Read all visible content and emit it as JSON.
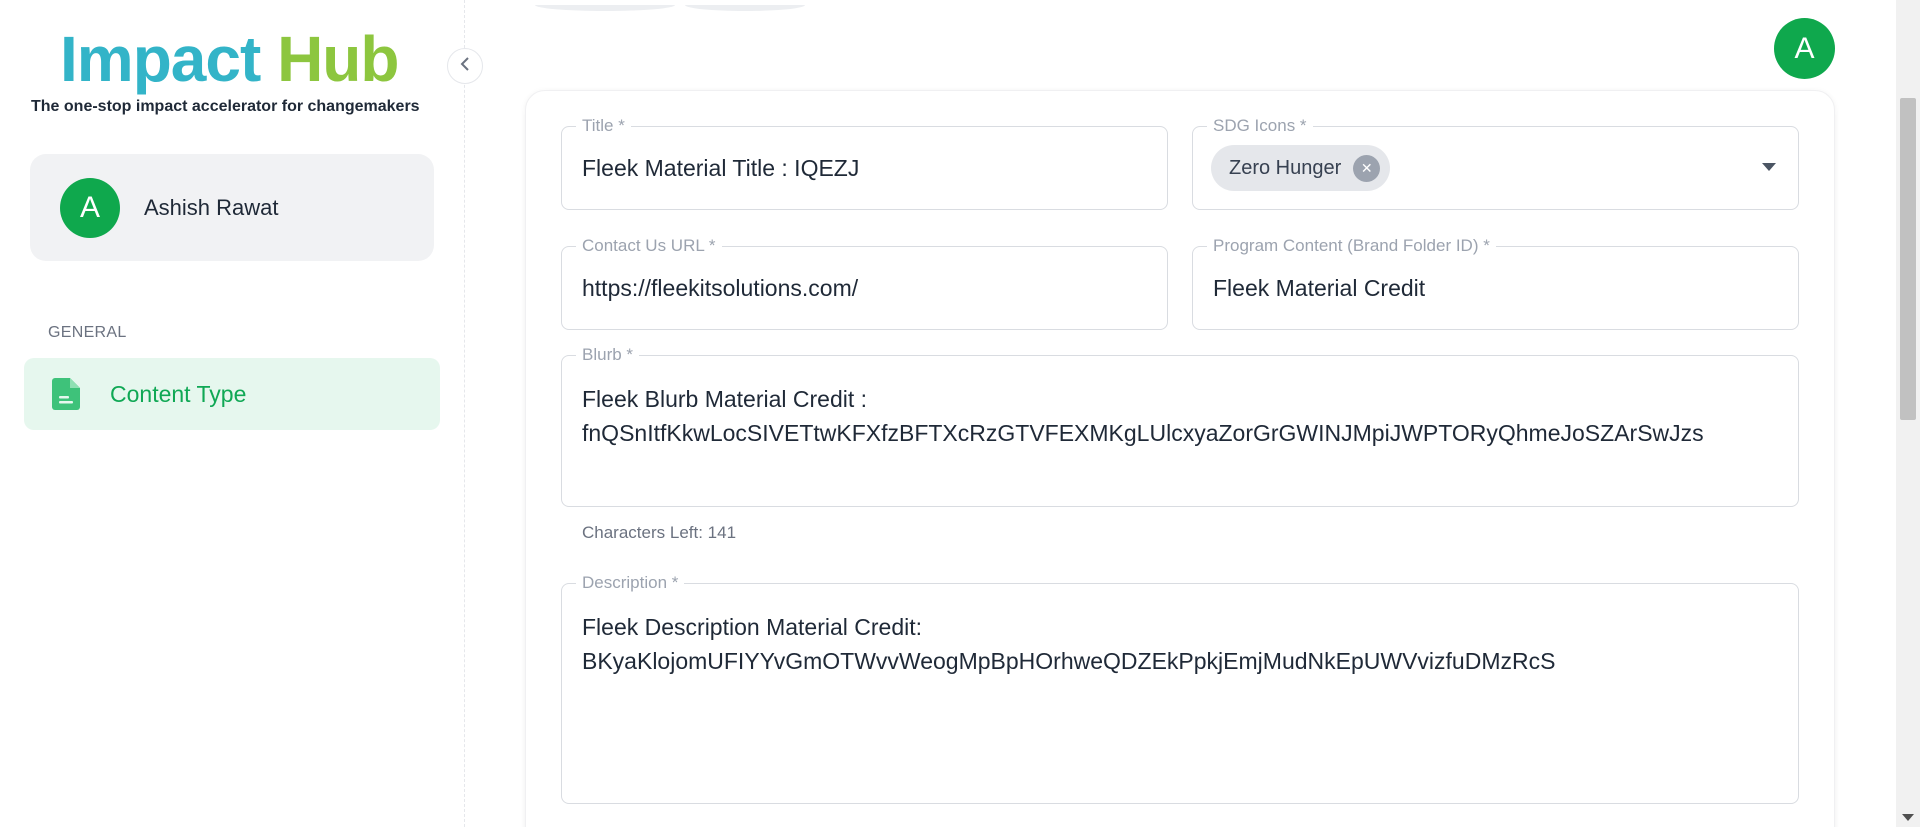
{
  "app": {
    "logo_word1": "Impact",
    "logo_word2": "Hub",
    "tagline": "The one-stop impact accelerator for changemakers",
    "brand_colors": {
      "teal": "#33b4c8",
      "green": "#8dc63f",
      "accent": "#0fa84d"
    }
  },
  "sidebar": {
    "collapse_icon": "chevron-left-icon",
    "user": {
      "initial": "A",
      "name": "Ashish Rawat"
    },
    "section_label": "GENERAL",
    "items": [
      {
        "label": "Content Type",
        "icon": "document-icon",
        "active": true
      }
    ]
  },
  "header": {
    "avatar_initial": "A"
  },
  "form": {
    "title": {
      "label": "Title *",
      "value": "Fleek Material Title : IQEZJ"
    },
    "sdg_icons": {
      "label": "SDG Icons *",
      "selected": [
        "Zero Hunger"
      ]
    },
    "contact_url": {
      "label": "Contact Us URL *",
      "value": "https://fleekitsolutions.com/"
    },
    "program_content": {
      "label": "Program Content (Brand Folder ID) *",
      "value": "Fleek Material Credit"
    },
    "blurb": {
      "label": "Blurb *",
      "line1": "Fleek Blurb Material Credit :",
      "line2": "fnQSnItfKkwLocSIVETtwKFXfzBFTXcRzGTVFEXMKgLUlcxyaZorGrGWINJMpiJWPTORyQhmeJoSZArSwJzs"
    },
    "characters_left": "Characters Left: 141",
    "description": {
      "label": "Description *",
      "line1": "Fleek Description Material Credit:",
      "line2": "BKyaKlojomUFIYYvGmOTWvvWeogMpBpHOrhweQDZEkPpkjEmjMudNkEpUWVvizfuDMzRcS"
    }
  }
}
